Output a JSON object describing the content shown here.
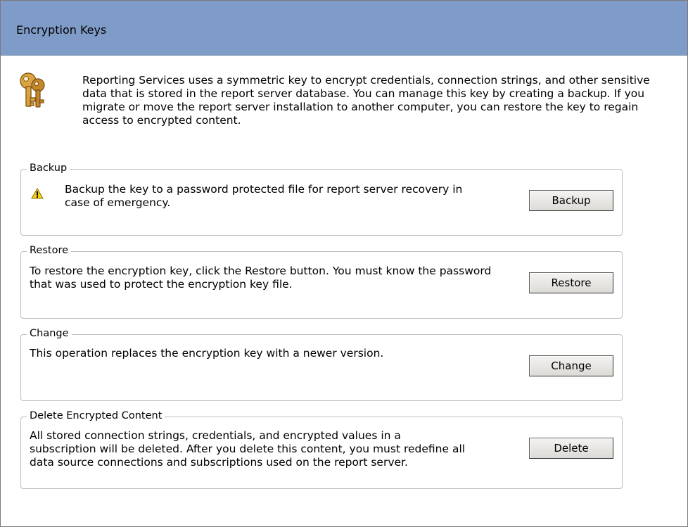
{
  "header": {
    "title": "Encryption Keys"
  },
  "intro": {
    "icon": "keys-icon",
    "text": "Reporting Services uses a symmetric key to encrypt credentials, connection strings, and other sensitive data that is stored in the report server database.  You can manage this key by creating a backup.  If you migrate or move the report server installation to another computer, you can restore the key to regain access to encrypted content."
  },
  "backup": {
    "legend": "Backup",
    "icon": "warning-icon",
    "description": "Backup the key to a password protected file for report server recovery in case of emergency.",
    "button_label": "Backup"
  },
  "restore": {
    "legend": "Restore",
    "description": "To restore the encryption key, click the Restore button.  You must know the password that was used to protect the encryption key file.",
    "button_label": "Restore"
  },
  "change": {
    "legend": "Change",
    "description": "This operation replaces the encryption key with a newer version.",
    "button_label": "Change"
  },
  "delete": {
    "legend": "Delete Encrypted Content",
    "description": "All stored connection strings, credentials, and encrypted values in a subscription will be deleted.  After you delete this content, you must redefine all data source connections and subscriptions used on the report server.",
    "button_label": "Delete"
  },
  "colors": {
    "header_background": "#7f9cc8",
    "group_border": "#bdbdbd",
    "warning_yellow": "#f5d216"
  }
}
